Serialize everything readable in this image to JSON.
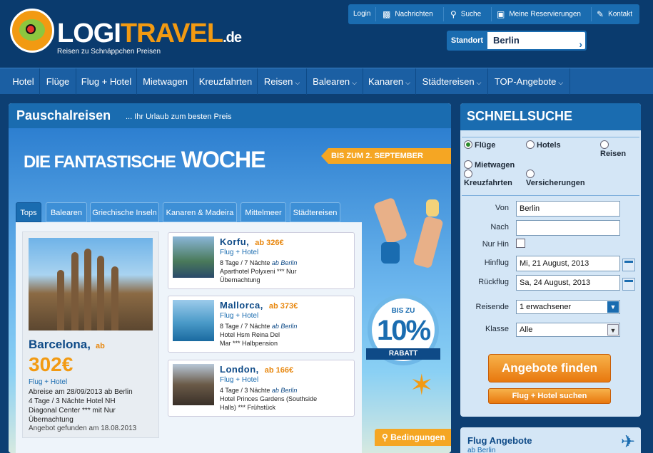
{
  "brand": {
    "name_part1": "LOGI",
    "name_part2": "TRAVEL",
    "domain": ".de",
    "tagline": "Reisen zu Schnäppchen Preisen"
  },
  "util": [
    {
      "label": "Login",
      "icon": ""
    },
    {
      "label": "Nachrichten",
      "icon": "speech-bubble-icon"
    },
    {
      "label": "Suche",
      "icon": "search-icon"
    },
    {
      "label": "Meine Reservierungen",
      "icon": "suitcase-icon"
    },
    {
      "label": "Kontakt",
      "icon": "edit-icon"
    }
  ],
  "standort": {
    "label": "Standort",
    "value": "Berlin"
  },
  "nav": [
    {
      "label": "Hotel",
      "dropdown": false
    },
    {
      "label": "Flüge",
      "dropdown": false
    },
    {
      "label": "Flug + Hotel",
      "dropdown": false
    },
    {
      "label": "Mietwagen",
      "dropdown": false
    },
    {
      "label": "Kreuzfahrten",
      "dropdown": false
    },
    {
      "label": "Reisen",
      "dropdown": true
    },
    {
      "label": "Balearen",
      "dropdown": true
    },
    {
      "label": "Kanaren",
      "dropdown": true
    },
    {
      "label": "Städtereisen",
      "dropdown": true
    },
    {
      "label": "TOP-Angebote",
      "dropdown": true
    }
  ],
  "main": {
    "title": "Pauschalreisen",
    "subtitle": "... Ihr Urlaub zum besten Preis"
  },
  "banner": {
    "line1": "DIE FANTASTISCHE",
    "line2": "WOCHE",
    "ribbon": "BIS ZUM 2. SEPTEMBER",
    "discount_top": "BIS ZU",
    "discount": "10%",
    "discount_label": "RABATT",
    "conditions": "Bedingungen"
  },
  "tabs": [
    "Tops",
    "Balearen",
    "Griechische Inseln",
    "Kanaren & Madeira",
    "Mittelmeer",
    "Städtereisen"
  ],
  "featured": {
    "city": "Barcelona,",
    "ab": "ab",
    "price": "302€",
    "type": "Flug + Hotel",
    "line1": "Abreise am 28/09/2013 ab Berlin",
    "line2": "4 Tage / 3 Nächte Hotel NH",
    "line3": "Diagonal Center *** mit Nur",
    "line4": "Übernachtung",
    "found": "Angebot gefunden am 18.08.2013"
  },
  "offers": [
    {
      "city": "Korfu,",
      "price": "ab 326€",
      "type": "Flug + Hotel",
      "duration": "8 Tage / 7 Nächte",
      "from": "ab Berlin",
      "hotel1": "Aparthotel Polyxeni ***  Nur",
      "hotel2": "Übernachtung"
    },
    {
      "city": "Mallorca,",
      "price": "ab 373€",
      "type": "Flug + Hotel",
      "duration": "8 Tage / 7 Nächte",
      "from": "ab Berlin",
      "hotel1": "Hotel Hsm Reina Del",
      "hotel2": "Mar ***  Halbpension"
    },
    {
      "city": "London,",
      "price": "ab 166€",
      "type": "Flug + Hotel",
      "duration": "4 Tage / 3 Nächte",
      "from": "ab Berlin",
      "hotel1": "Hotel Princes Gardens (Southside",
      "hotel2": "Halls) ***  Frühstück"
    }
  ],
  "quick": {
    "title": "SCHNELLSUCHE",
    "radios": [
      {
        "label": "Flüge",
        "selected": true
      },
      {
        "label": "Hotels",
        "selected": false
      },
      {
        "label": "Reisen",
        "selected": false
      },
      {
        "label": "Mietwagen",
        "selected": false
      },
      {
        "label": "Kreuzfahrten",
        "selected": false
      },
      {
        "label": "Versicherungen",
        "selected": false
      }
    ],
    "von_label": "Von",
    "von_value": "Berlin",
    "nach_label": "Nach",
    "nach_value": "",
    "nurhin_label": "Nur Hin",
    "hinflug_label": "Hinflug",
    "hinflug_value": "Mi, 21 August, 2013",
    "rueckflug_label": "Rückflug",
    "rueckflug_value": "Sa, 24 August, 2013",
    "reisende_label": "Reisende",
    "reisende_value": "1 erwachsener",
    "klasse_label": "Klasse",
    "klasse_value": "Alle",
    "search_button": "Angebote finden",
    "flight_hotel_button": "Flug + Hotel suchen"
  },
  "flug_angebote": {
    "title": "Flug Angebote",
    "sub": "ab Berlin"
  },
  "colors": {
    "header": "#0a3b6e",
    "nav": "#1b5fa3",
    "accent": "#f29a12",
    "blue": "#1a6cb0"
  }
}
